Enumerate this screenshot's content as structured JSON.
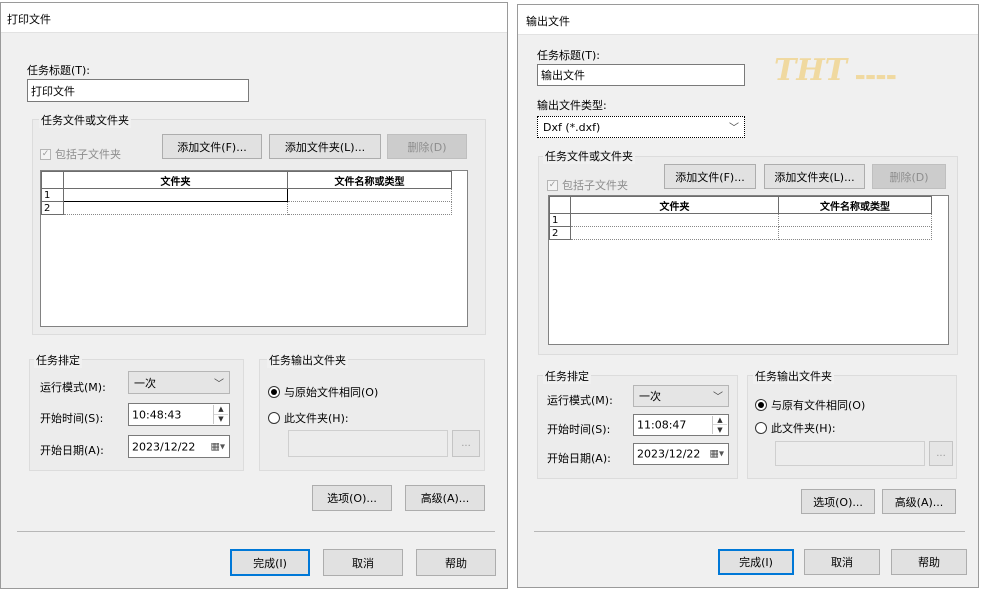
{
  "left": {
    "title": "打印文件",
    "task_title_label": "任务标题(T):",
    "task_title_value": "打印文件",
    "files_group": "任务文件或文件夹",
    "include_sub": "包括子文件夹",
    "add_file": "添加文件(F)...",
    "add_folder": "添加文件夹(L)...",
    "delete": "删除(D)",
    "col_folder": "文件夹",
    "col_name": "文件名称或类型",
    "rows": [
      "1",
      "2"
    ],
    "schedule_group": "任务排定",
    "run_mode_label": "运行模式(M):",
    "run_mode_value": "一次",
    "start_time_label": "开始时间(S):",
    "start_time_value": "10:48:43",
    "start_date_label": "开始日期(A):",
    "start_date_value": "2023/12/22",
    "output_group": "任务输出文件夹",
    "radio_same": "与原始文件相同(O)",
    "radio_this": "此文件夹(H):",
    "browse": "...",
    "options": "选项(O)...",
    "advanced": "高级(A)...",
    "finish": "完成(I)",
    "cancel": "取消",
    "help": "帮助"
  },
  "right": {
    "title": "输出文件",
    "task_title_label": "任务标题(T):",
    "task_title_value": "输出文件",
    "file_type_label": "输出文件类型:",
    "file_type_value": "Dxf (*.dxf)",
    "files_group": "任务文件或文件夹",
    "include_sub": "包括子文件夹",
    "add_file": "添加文件(F)...",
    "add_folder": "添加文件夹(L)...",
    "delete": "删除(D)",
    "col_folder": "文件夹",
    "col_name": "文件名称或类型",
    "rows": [
      "1",
      "2"
    ],
    "schedule_group": "任务排定",
    "run_mode_label": "运行模式(M):",
    "run_mode_value": "一次",
    "start_time_label": "开始时间(S):",
    "start_time_value": "11:08:47",
    "start_date_label": "开始日期(A):",
    "start_date_value": "2023/12/22",
    "output_group": "任务输出文件夹",
    "radio_same": "与原有文件相同(O)",
    "radio_this": "此文件夹(H):",
    "browse": "...",
    "options": "选项(O)...",
    "advanced": "高级(A)...",
    "finish": "完成(I)",
    "cancel": "取消",
    "help": "帮助"
  },
  "watermark": "THT"
}
